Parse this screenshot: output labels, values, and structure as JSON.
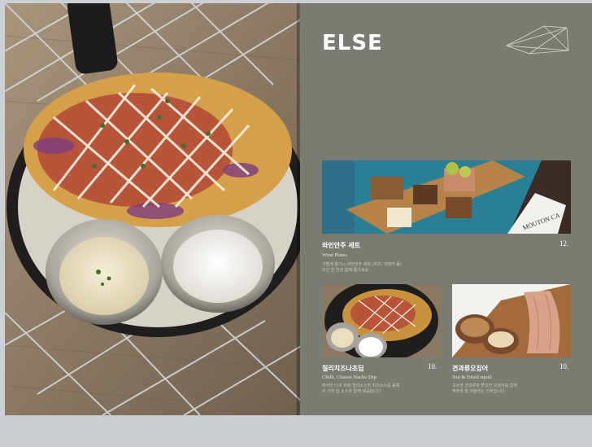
{
  "section": {
    "title": "ELSE"
  },
  "items": [
    {
      "name": "와인안주 세트",
      "eng": "Wine Plates",
      "price": "12.",
      "desc": "가볍게 즐기는 와인안주 세트 (치즈, 크래커 등)\n와인 한 잔과 함께 즐기세요"
    },
    {
      "name": "칠리치즈나초딥",
      "eng": "Chilli, Cheese Nacho Dip",
      "price": "10.",
      "desc": "바삭한 나초 위에 칠리소스와 치즈소스를 듬뿍\n두 가지 딥 소스와 함께 제공됩니다"
    },
    {
      "name": "견과류오징어",
      "eng": "Nut & Dried squid",
      "price": "10.",
      "desc": "고소한 견과류와 쫄깃한 오징어를 함께\n맥주와 잘 어울리는 안주입니다"
    }
  ],
  "icons": {
    "decoration": "polygon-line-icon",
    "wine_label": "wine-bottle-label"
  },
  "wine_label_text": "MOUTON CA",
  "colors": {
    "right_page_bg": "#7a7c74",
    "text": "#ffffff"
  }
}
